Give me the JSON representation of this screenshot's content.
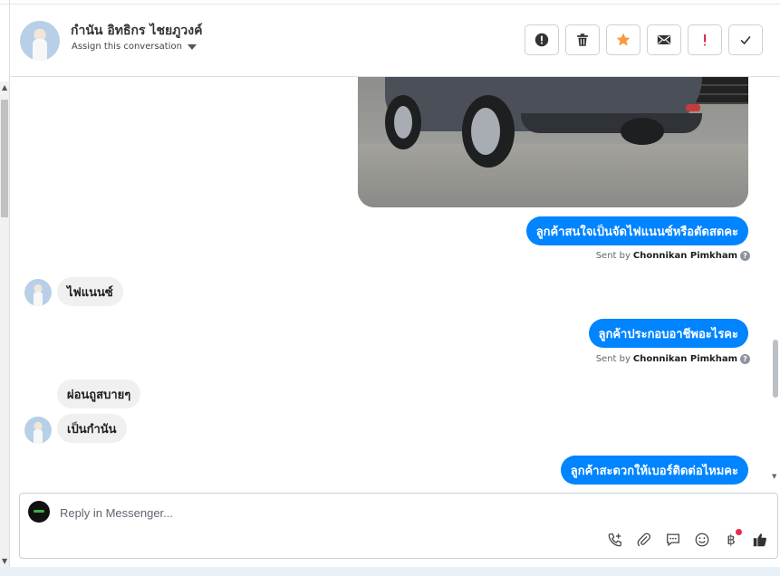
{
  "header": {
    "contact_name": "กำนัน อิทธิกร ไชยภูวงค์",
    "assign_label": "Assign this conversation"
  },
  "actions": [
    {
      "name": "spam-button",
      "icon": "alert-circle-icon"
    },
    {
      "name": "delete-button",
      "icon": "trash-icon"
    },
    {
      "name": "star-button",
      "icon": "star-icon",
      "color": "#f79a3e"
    },
    {
      "name": "mark-unread-button",
      "icon": "envelope-icon"
    },
    {
      "name": "important-button",
      "icon": "exclamation-icon",
      "color": "#e41e3f"
    },
    {
      "name": "done-button",
      "icon": "check-icon"
    }
  ],
  "messages": [
    {
      "type": "image",
      "direction": "out",
      "description": "car-photo"
    },
    {
      "direction": "out",
      "text": "ลูกค้าสนใจเป็นจัดไฟแนนซ์หรือตัดสดคะ",
      "sent_by_prefix": "Sent by",
      "sent_by": "Chonnikan Pimkham"
    },
    {
      "direction": "in",
      "text": "ไฟแนนซ์"
    },
    {
      "direction": "out",
      "text": "ลูกค้าประกอบอาชีพอะไรคะ",
      "sent_by_prefix": "Sent by",
      "sent_by": "Chonnikan Pimkham"
    },
    {
      "direction": "in",
      "text": "ผ่อนถูสบายๆ"
    },
    {
      "direction": "in",
      "text": "เป็นกำนัน"
    },
    {
      "direction": "out",
      "text": "ลูกค้าสะดวกให้เบอร์ติดต่อไหมคะ"
    }
  ],
  "composer": {
    "placeholder": "Reply in Messenger...",
    "value": "",
    "tools": [
      "phone-plus-icon",
      "paperclip-icon",
      "saved-reply-icon",
      "emoji-icon",
      "baht-icon",
      "thumbs-up-icon"
    ]
  },
  "colors": {
    "outgoing_bubble": "#0084ff",
    "incoming_bubble": "#f0f0f0",
    "star": "#f79a3e",
    "important": "#e41e3f",
    "notification_dot": "#f02849"
  }
}
